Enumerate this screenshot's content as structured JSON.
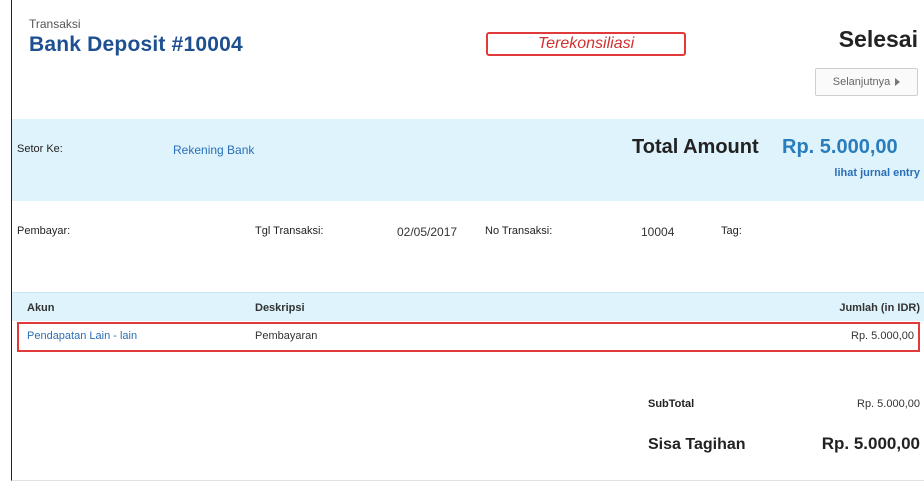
{
  "header": {
    "type_label": "Transaksi",
    "title": "Bank Deposit #10004",
    "status_badge": "Terekonsiliasi",
    "status": "Selesai",
    "next_button": "Selanjutnya"
  },
  "summary": {
    "deposit_to_label": "Setor Ke:",
    "deposit_to_value": "Rekening Bank",
    "total_label": "Total Amount",
    "total_value": "Rp. 5.000,00",
    "journal_link": "lihat jurnal entry"
  },
  "meta": {
    "payer_label": "Pembayar:",
    "date_label": "Tgl Transaksi:",
    "date_value": "02/05/2017",
    "number_label": "No Transaksi:",
    "number_value": "10004",
    "tag_label": "Tag:"
  },
  "table": {
    "columns": [
      "Akun",
      "Deskripsi",
      "Jumlah (in IDR)"
    ],
    "rows": [
      {
        "account": "Pendapatan Lain - lain",
        "description": "Pembayaran",
        "amount": "Rp. 5.000,00"
      }
    ]
  },
  "totals": {
    "subtotal_label": "SubTotal",
    "subtotal_value": "Rp. 5.000,00",
    "balance_label": "Sisa Tagihan",
    "balance_value": "Rp. 5.000,00"
  },
  "colors": {
    "accent": "#1d4f91",
    "link": "#2a6fb7",
    "band": "#def3fb",
    "highlight": "#e03a3a"
  }
}
